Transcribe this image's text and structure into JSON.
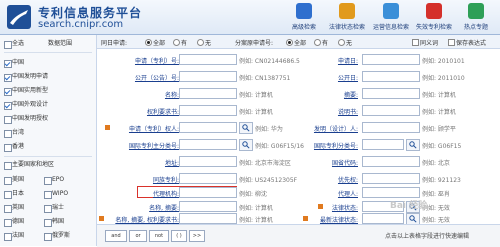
{
  "header": {
    "title": "专利信息服务平台",
    "url": "search.cnipr.com",
    "nav": [
      {
        "label": "高级检索",
        "color": "#2f6fce",
        "icon": "search-icon"
      },
      {
        "label": "法律状态检索",
        "color": "#e19a1d",
        "icon": "law-icon"
      },
      {
        "label": "运营信息检索",
        "color": "#3b8fd8",
        "icon": "operation-icon"
      },
      {
        "label": "失效专利检索",
        "color": "#d4302b",
        "icon": "invalid-icon"
      },
      {
        "label": "热点专题",
        "color": "#2e9f57",
        "icon": "hotspot-icon"
      }
    ]
  },
  "sidebar": {
    "select_all": "全选",
    "data_range": "数据范围",
    "items": [
      {
        "label": "中国",
        "checked": true
      },
      {
        "label": "中国发明申请",
        "checked": true
      },
      {
        "label": "中国实用新型",
        "checked": true
      },
      {
        "label": "中国外观设计",
        "checked": true
      },
      {
        "label": "中国发明授权",
        "checked": false
      },
      {
        "label": "台湾",
        "checked": false
      },
      {
        "label": "香港",
        "checked": false
      }
    ],
    "group2_title": "主要国家和地区",
    "countries": [
      [
        "美国",
        "EPO"
      ],
      [
        "日本",
        "WIPO"
      ],
      [
        "英国",
        "瑞士"
      ],
      [
        "德国",
        "韩国"
      ],
      [
        "法国",
        "俄罗斯"
      ]
    ]
  },
  "filters": {
    "same_application": "同日申请:",
    "all1": "全部",
    "yes1": "有",
    "no1": "无",
    "divisional": "分案原申请号:",
    "all2": "全部",
    "yes2": "有",
    "no2": "无",
    "same_family": "同义词",
    "save_expr": "保存表达式"
  },
  "form": {
    "left": [
      {
        "label": "申请（专利）号:",
        "hint": "例如: CN02144686.5"
      },
      {
        "label": "公开（公告）号:",
        "hint": "例如: CN1387751"
      },
      {
        "label": "名称:",
        "hint": "例如: 计算机"
      },
      {
        "label": "权利要求书:",
        "hint": "例如: 计算机"
      },
      {
        "label": "申请（专利）权人:",
        "hint": "例如: 华为"
      },
      {
        "label": "国际专利主分类号:",
        "hint": "例如: G06F15/16"
      },
      {
        "label": "地址:",
        "hint": "例如: 北京市海淀区"
      },
      {
        "label": "同族专利:",
        "hint": "例如: US24512305F"
      },
      {
        "label": "代理机构:",
        "hint": "例如: 柳沈"
      },
      {
        "label": "名称, 摘要:",
        "hint": "例如: 计算机"
      },
      {
        "label": "名称, 摘要, 权利要求书:",
        "hint": "例如: 计算机"
      }
    ],
    "right": [
      {
        "label": "申请日:",
        "hint": "例如: 2010101"
      },
      {
        "label": "公开日:",
        "hint": "例如: 2011010"
      },
      {
        "label": "摘要:",
        "hint": "例如: 计算机"
      },
      {
        "label": "说明书:",
        "hint": "例如: 计算机"
      },
      {
        "label": "发明（设计）人:",
        "hint": "例如: 顾学平"
      },
      {
        "label": "国际专利分类号:",
        "hint": "例如: G06F15"
      },
      {
        "label": "国省代码:",
        "hint": "例如: 北京"
      },
      {
        "label": "优先权:",
        "hint": "例如: 921123"
      },
      {
        "label": "代理人:",
        "hint": "例如: 巫肖"
      },
      {
        "label": "法律状态:",
        "hint": "例如: 无效"
      },
      {
        "label": "最新法律状态:",
        "hint": "例如: 无效"
      }
    ]
  },
  "bottom": {
    "ops": [
      "and",
      "or",
      "not",
      "( )",
      ">>"
    ],
    "tip": "点击以上表格字段进行快速编辑",
    "watermark": "Bai 经验"
  }
}
